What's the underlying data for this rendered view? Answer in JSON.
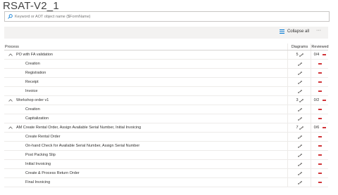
{
  "page": {
    "title": "RSAT-V2_1"
  },
  "search": {
    "placeholder": "Keyword or AOT object name ($FormName)"
  },
  "toolbar": {
    "collapse_label": "Collapse all",
    "more_label": "···"
  },
  "table": {
    "headers": {
      "process": "Process",
      "diagrams": "Diagrams",
      "reviewed": "Reviewed"
    },
    "rows": [
      {
        "type": "group",
        "label": "PO with FA validation",
        "diagrams": "5",
        "reviewed": "0/4"
      },
      {
        "type": "child",
        "label": "Creation"
      },
      {
        "type": "child",
        "label": "Registration"
      },
      {
        "type": "child",
        "label": "Receipt"
      },
      {
        "type": "child",
        "label": "Invoice"
      },
      {
        "type": "group",
        "label": "Workshop order v1",
        "diagrams": "3",
        "reviewed": "0/2"
      },
      {
        "type": "child",
        "label": "Creation"
      },
      {
        "type": "child",
        "label": "Capitalization"
      },
      {
        "type": "group",
        "label": "AM Create Rental Order, Assign Available Serial Number, Initial Invoicing",
        "diagrams": "7",
        "reviewed": "0/6"
      },
      {
        "type": "child",
        "label": "Create Rental Order"
      },
      {
        "type": "child",
        "label": "On-hand Check for Available Serial Number, Assign Serial Number"
      },
      {
        "type": "child",
        "label": "Post Packing Slip"
      },
      {
        "type": "child",
        "label": "Initial Invoicing"
      },
      {
        "type": "child",
        "label": "Create & Process Return Order"
      },
      {
        "type": "child",
        "label": "Final Invoicing"
      }
    ]
  },
  "icons": {
    "search": "search-icon",
    "collapse": "collapse-all-icon",
    "diagram": "diagram-icon",
    "chevron": "chevron-up-icon",
    "status": "minus-icon"
  },
  "colors": {
    "accent": "#0078d4",
    "status_red": "#d13438",
    "toolbar_bg": "#f3f2f1"
  }
}
